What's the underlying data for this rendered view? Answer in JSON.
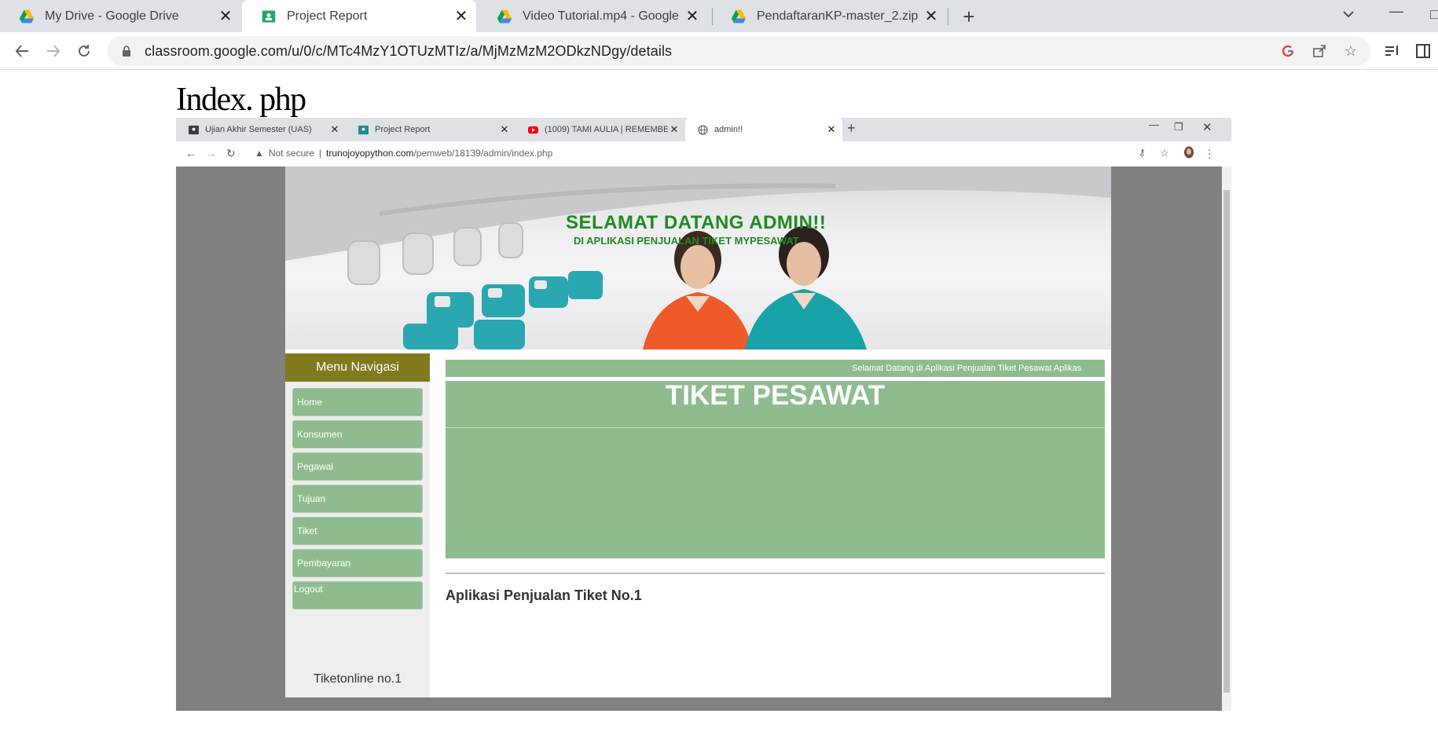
{
  "browser": {
    "tabs": [
      {
        "title": "My Drive - Google Drive",
        "icon": "google-drive-icon"
      },
      {
        "title": "Project Report",
        "icon": "classroom-icon",
        "active": true
      },
      {
        "title": "Video Tutorial.mp4 - Google Driv",
        "icon": "google-drive-icon"
      },
      {
        "title": "PendaftaranKP-master_2.zip - Go",
        "icon": "google-drive-icon"
      }
    ],
    "url": "classroom.google.com/u/0/c/MTc4MzY1OTUzMTIz/a/MjMzMzM2ODkzNDgy/details"
  },
  "page": {
    "heading": "Index. php"
  },
  "screenshot": {
    "tabs": [
      {
        "title": "Ujian Akhir Semester (UAS)",
        "icon": "classroom-icon"
      },
      {
        "title": "Project Report",
        "icon": "classroom-icon"
      },
      {
        "title": "(1009) TAMI AULIA | REMEMBER",
        "icon": "youtube-icon"
      },
      {
        "title": "admin!!",
        "icon": "globe-icon",
        "active": true
      }
    ],
    "security_label": "Not secure",
    "url_host": "trunojoyopython.com",
    "url_path": "/pemweb/18139/admin/index.php",
    "site": {
      "hero_title": "SELAMAT DATANG ADMIN!!",
      "hero_subtitle": "DI APLIKASI PENJUALAN TIKET MYPESAWAT",
      "menu_heading": "Menu Navigasi",
      "menu_items": [
        "Home",
        "Konsumen",
        "Pegawai",
        "Tujuan",
        "Tiket",
        "Pembayaran",
        "Logout"
      ],
      "sidebar_footer": "Tiketonline no.1",
      "marquee_text": "Selamat Datang di Aplikasi Penjualan Tiket Pesawat Aplikas",
      "banner_title": "TIKET PESAWAT",
      "footer_text": "Aplikasi Penjualan Tiket No.1"
    }
  },
  "colors": {
    "accent_green": "#8fbc8f",
    "menu_header": "#807a1e",
    "hero_text": "#1f8a1f"
  }
}
